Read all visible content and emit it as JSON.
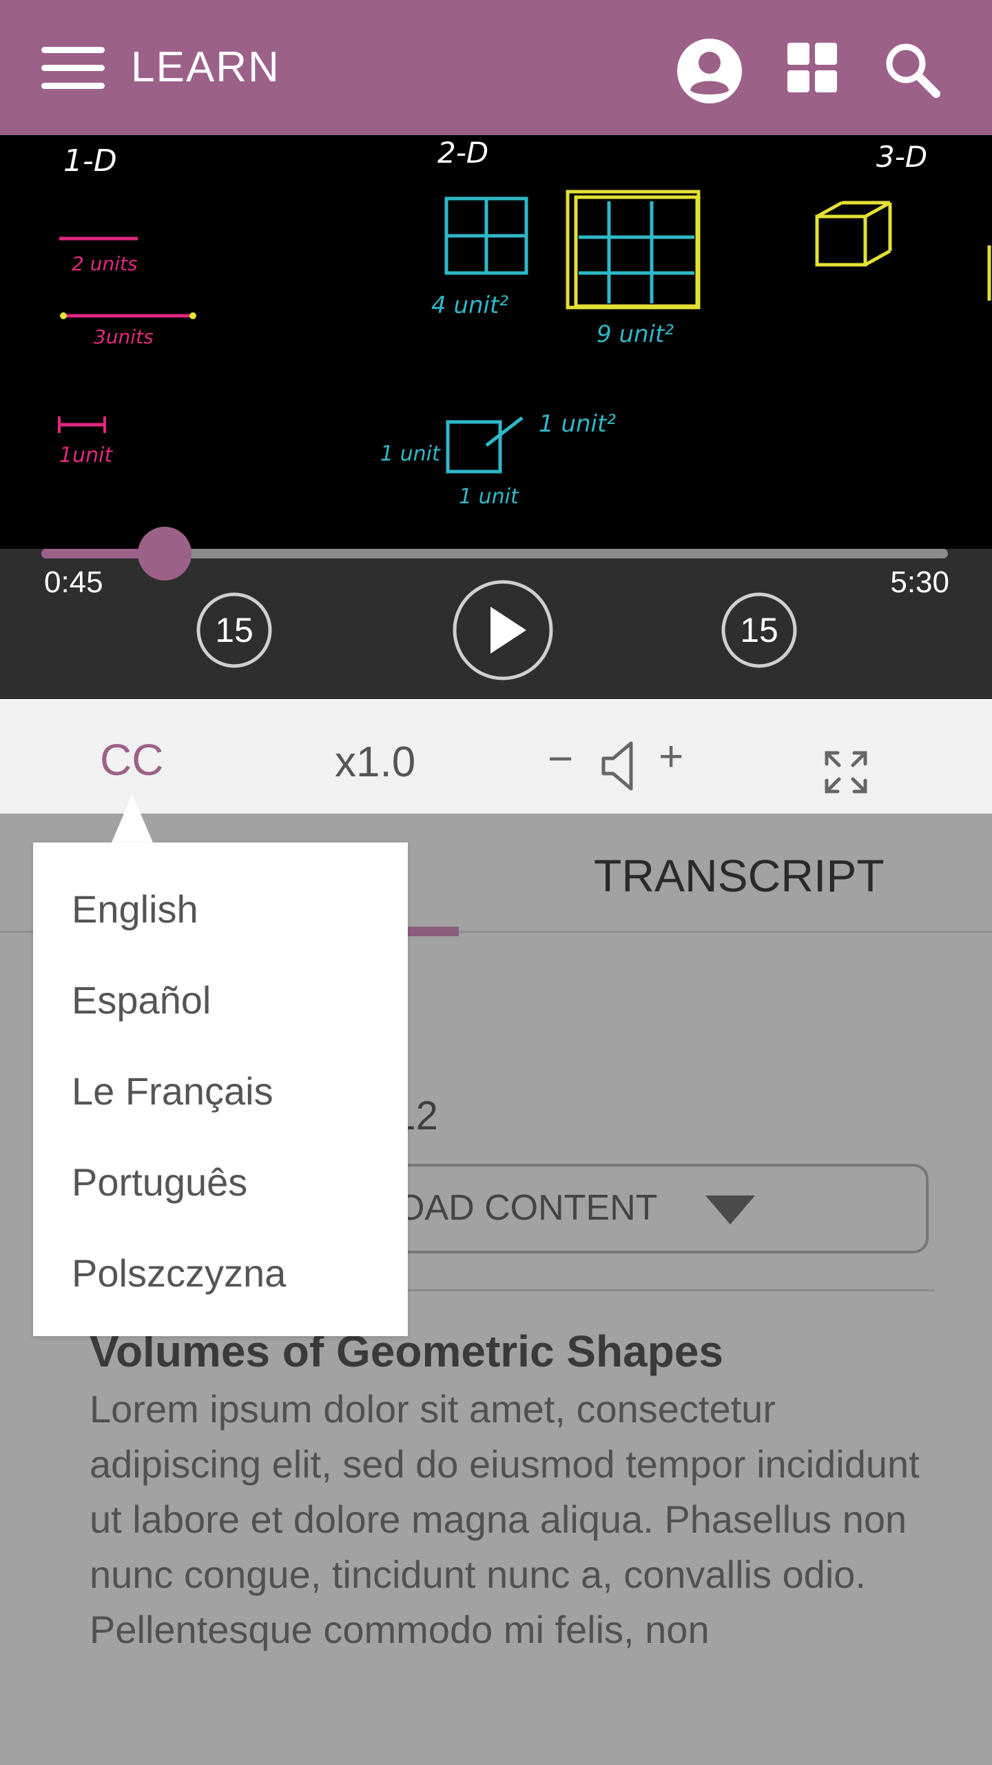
{
  "header": {
    "brand": "LEARN",
    "brand_color": "#9c6189"
  },
  "video": {
    "current_time": "0:45",
    "total_time": "5:30",
    "progress_fraction": 0.136,
    "skip_back_seconds": "15",
    "skip_forward_seconds": "15",
    "board_labels": {
      "one_d": "1-D",
      "two_d": "2-D",
      "three_d": "3-D",
      "two_units": "2 units",
      "three_units": "3units",
      "one_unit": "1unit",
      "four_units_sq": "4 unit²",
      "nine_units_sq": "9 unit²",
      "one_unit_left": "1 unit",
      "one_unit_bottom": "1 unit",
      "one_unit_sq": "1 unit²"
    }
  },
  "controls": {
    "cc_label": "CC",
    "speed_label": "x1.0",
    "volume_minus": "−",
    "volume_plus": "+"
  },
  "captions_menu": {
    "options": [
      "English",
      "Español",
      "Le Français",
      "Português",
      "Polszczyzna"
    ]
  },
  "content": {
    "tab_transcript": "TRANSCRIPT",
    "author": "r: CK-12",
    "download_label": "OAD CONTENT",
    "title": "Volumes of Geometric Shapes",
    "body": "Lorem ipsum dolor sit amet, consectetur adipiscing elit, sed do eiusmod tempor incididunt ut labore et dolore magna aliqua. Phasellus non nunc congue, tincidunt nunc a, convallis odio. Pellentesque commodo mi felis, non"
  }
}
